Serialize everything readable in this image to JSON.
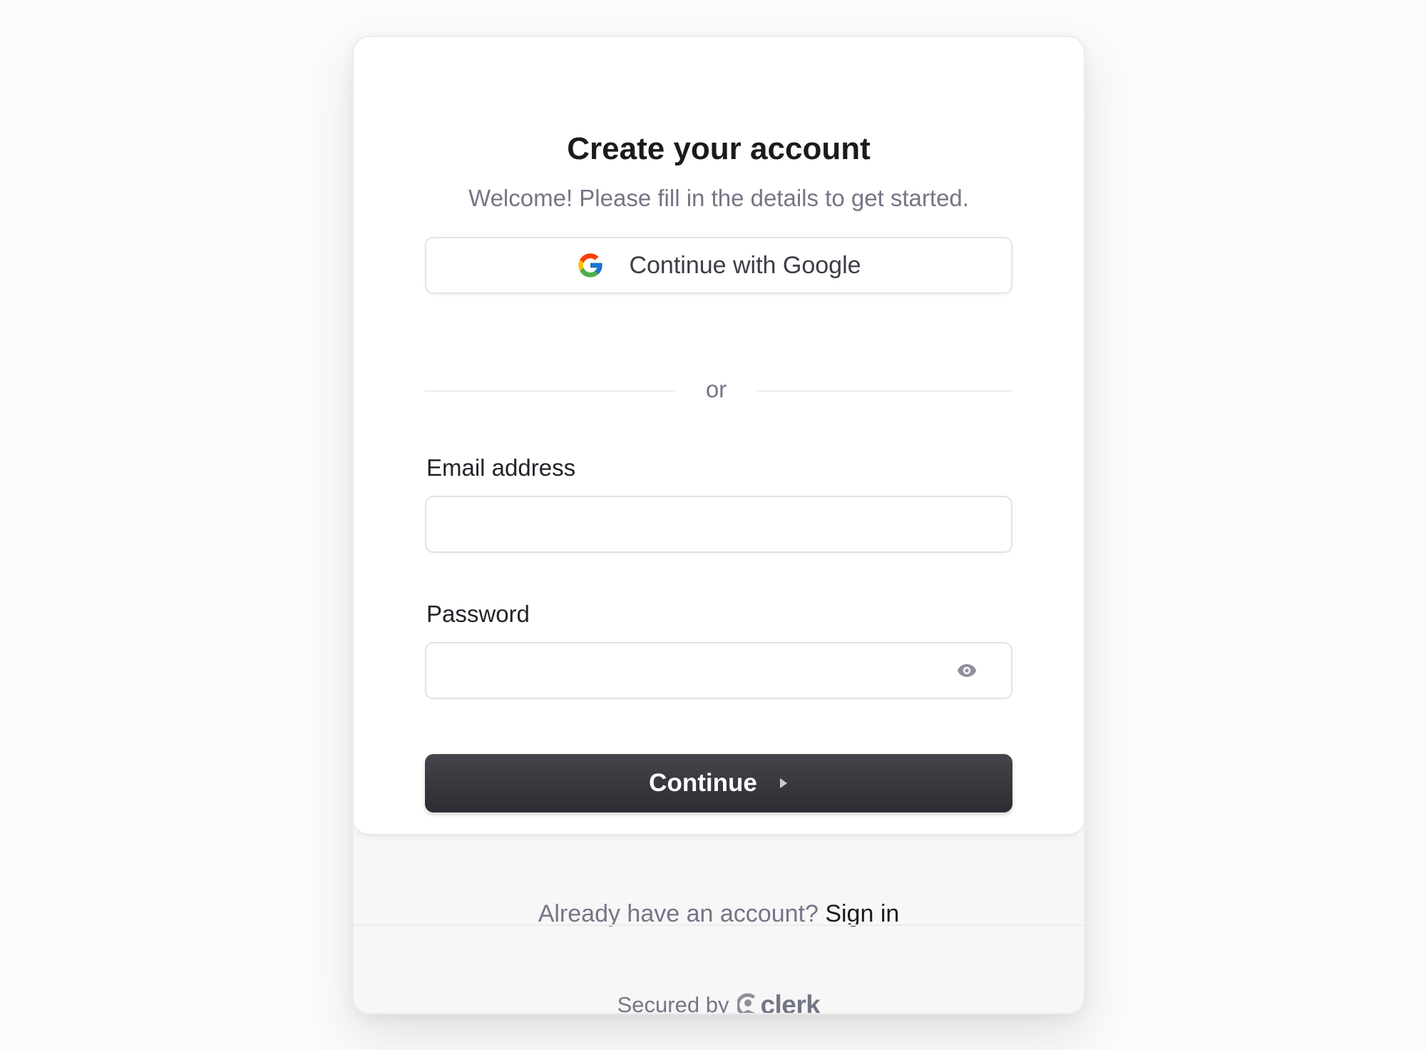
{
  "card": {
    "title": "Create your account",
    "subtitle": "Welcome! Please fill in the details to get started."
  },
  "social": {
    "google_label": "Continue with Google",
    "google_icon": "google-icon"
  },
  "divider": {
    "text": "or"
  },
  "form": {
    "email_label": "Email address",
    "email_value": "",
    "email_placeholder": "",
    "password_label": "Password",
    "password_value": "",
    "password_placeholder": "",
    "show_password_icon": "eye-icon",
    "continue_label": "Continue",
    "continue_icon": "caret-right-icon"
  },
  "footer": {
    "signin_prompt": "Already have an account?",
    "signin_link": "Sign in",
    "secured_by": "Secured by",
    "brand": "clerk",
    "brand_icon": "clerk-logo-icon"
  },
  "colors": {
    "primary_button": "#2f3037",
    "text_primary": "#1b1b1f",
    "text_muted": "#747686",
    "border": "#e5e5e8",
    "background": "#fbfbfb"
  }
}
